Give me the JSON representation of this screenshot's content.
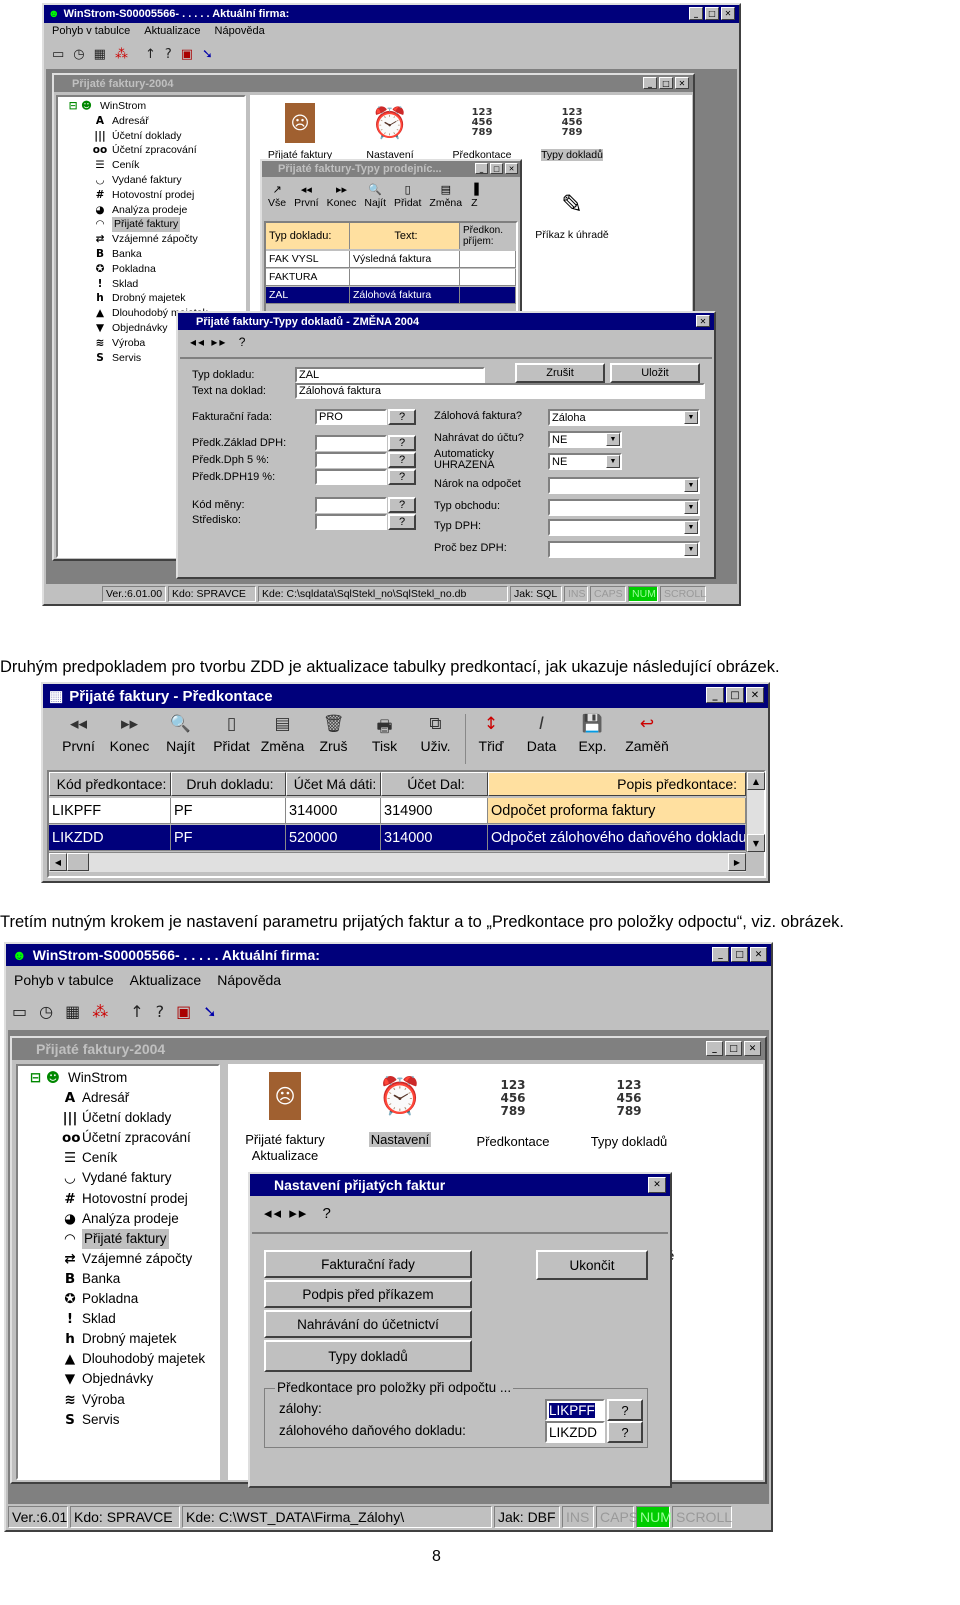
{
  "s1": {
    "title": "WinStrom-S00005566- . . . . .  Aktuální firma:",
    "menu": [
      "Pohyb v tabulce",
      "Aktualizace",
      "Nápověda"
    ],
    "toolbar_icons": [
      "open-icon",
      "clock-icon",
      "calculator-icon",
      "tree-icon",
      "arrow-up-icon",
      "help-icon",
      "printer-icon",
      "pin-icon"
    ],
    "child_title": "Přijaté faktury-2004",
    "tree": [
      {
        "icon": "globe-icon",
        "glyph": "☻",
        "label": "WinStrom"
      },
      {
        "icon": "letter-a-icon",
        "glyph": "A",
        "label": "Adresář"
      },
      {
        "icon": "columns-icon",
        "glyph": "|||",
        "label": "Účetní doklady"
      },
      {
        "icon": "link-icon",
        "glyph": "oo",
        "label": "Účetní zpracování"
      },
      {
        "icon": "list-icon",
        "glyph": "☰",
        "label": "Ceník"
      },
      {
        "icon": "arc-icon",
        "glyph": "◡",
        "label": "Vydané faktury"
      },
      {
        "icon": "grid-icon",
        "glyph": "#",
        "label": "Hotovostní prodej"
      },
      {
        "icon": "pie-icon",
        "glyph": "◕",
        "label": "Analýza prodeje"
      },
      {
        "icon": "arc-top-icon",
        "glyph": "◠",
        "label": "Přijaté faktury"
      },
      {
        "icon": "swap-icon",
        "glyph": "⇄",
        "label": "Vzájemné zápočty"
      },
      {
        "icon": "letter-b-icon",
        "glyph": "B",
        "label": "Banka"
      },
      {
        "icon": "cash-icon",
        "glyph": "✪",
        "label": "Pokladna"
      },
      {
        "icon": "pin-icon",
        "glyph": "!",
        "label": "Sklad"
      },
      {
        "icon": "tool-icon",
        "glyph": "h",
        "label": "Drobný majetek"
      },
      {
        "icon": "bell-icon",
        "glyph": "▲",
        "label": "Dlouhodobý majetek"
      },
      {
        "icon": "cup-icon",
        "glyph": "▼",
        "label": "Objednávky"
      },
      {
        "icon": "factory-icon",
        "glyph": "≋",
        "label": "Výroba"
      },
      {
        "icon": "letter-s-icon",
        "glyph": "S",
        "label": "Servis"
      }
    ],
    "big_icons": [
      "Přijaté faktury",
      "Nastavení",
      "Předkontace",
      "Typy dokladů",
      "Příkaz k úhradě"
    ],
    "prodej_title": "Přijaté faktury-Typy prodejníc...",
    "prodej_tools": [
      "Vše",
      "První",
      "Konec",
      "Najít",
      "Přidat",
      "Změna",
      "Z"
    ],
    "prodej_headers": [
      "Typ dokladu:",
      "Text:",
      "Předkon. příjem:"
    ],
    "prodej_rows": [
      [
        "FAK VYSL",
        "Výsledná faktura",
        ""
      ],
      [
        "FAKTURA",
        "",
        ""
      ],
      [
        "ZAL",
        "Zálohová faktura",
        ""
      ]
    ],
    "dlg": {
      "title": "Přijaté faktury-Typy dokladů - ZMĚNA 2004",
      "typ_label": "Typ dokladu:",
      "typ_value": "ZAL",
      "text_label": "Text na doklad:",
      "text_value": "Zálohová faktura",
      "zrusit": "Zrušit",
      "ulozit": "Uložit",
      "rada_label": "Fakturační řada:",
      "rada_value": "PRO",
      "left_labels": [
        "Předk.Základ DPH:",
        "Předk.Dph  5 %:",
        "Předk.DPH19 %:"
      ],
      "kod_label": "Kód měny:",
      "stredisko_label": "Středisko:",
      "right_labels": [
        "Zálohová faktura?",
        "Nahrávat do účtu?",
        "Automaticky UHRAZENA",
        "Nárok na odpočet",
        "Typ obchodu:",
        "Typ DPH:",
        "Proč bez DPH:"
      ],
      "right_values": [
        "Záloha",
        "NE",
        "NE",
        "",
        "",
        "",
        ""
      ],
      "q": "?"
    },
    "status": [
      "Ver.:6.01.00",
      "Kdo: SPRAVCE",
      "Kde: C:\\sqldata\\SqlStekl_no\\SqlStekl_no.db",
      "Jak: SQL",
      "INS",
      "CAPS",
      "NUM",
      "SCROLL"
    ]
  },
  "para1": "Druhým predpokladem pro tvorbu ZDD je aktualizace tabulky predkontací, jak ukazuje následující obrázek.",
  "s2": {
    "title": "Přijaté faktury - Předkontace",
    "tools": [
      "První",
      "Konec",
      "Najít",
      "Přidat",
      "Změna",
      "Zruš",
      "Tisk",
      "Uživ.",
      "Třiď",
      "Data",
      "Exp.",
      "Zaměň"
    ],
    "headers": [
      "Kód předkontace:",
      "Druh dokladu:",
      "Účet Má dáti:",
      "Účet Dal:",
      "Popis předkontace:"
    ],
    "rows": [
      [
        "LIKPFF",
        "PF",
        "314000",
        "314900",
        "Odpočet proforma faktury"
      ],
      [
        "LIKZDD",
        "PF",
        "520000",
        "314000",
        "Odpočet zálohového daňového dokladu"
      ]
    ]
  },
  "para2": "Tretím nutným krokem je nastavení parametru prijatých faktur a to „Predkontace pro položky odpoctu“, viz. obrázek.",
  "s3": {
    "title": "WinStrom-S00005566- . . . . .  Aktuální firma:",
    "child_title": "Přijaté faktury-2004",
    "big_icons": [
      "Přijaté faktury Aktualizace",
      "Nastavení",
      "Předkontace",
      "Typy dokladů"
    ],
    "dlg_title": "Nastavení přijatých faktur",
    "buttons": [
      "Fakturační řady",
      "Podpis před příkazem",
      "Nahrávání do účetnictví",
      "Typy dokladů"
    ],
    "ukoncit": "Ukončit",
    "group_label": "Předkontace pro položky při odpočtu ...",
    "zalohy_label": "zálohy:",
    "zalohy_value": "LIKPFF",
    "zdd_label": "zálohového daňového dokladu:",
    "zdd_value": "LIKZDD",
    "stray": "ě",
    "status": [
      "Ver.:6.01",
      "Kdo: SPRAVCE",
      "Kde: C:\\WST_DATA\\Firma_Zálohy\\",
      "Jak: DBF",
      "INS",
      "CAPS",
      "NUM",
      "SCROLL"
    ]
  },
  "page_number": "8"
}
